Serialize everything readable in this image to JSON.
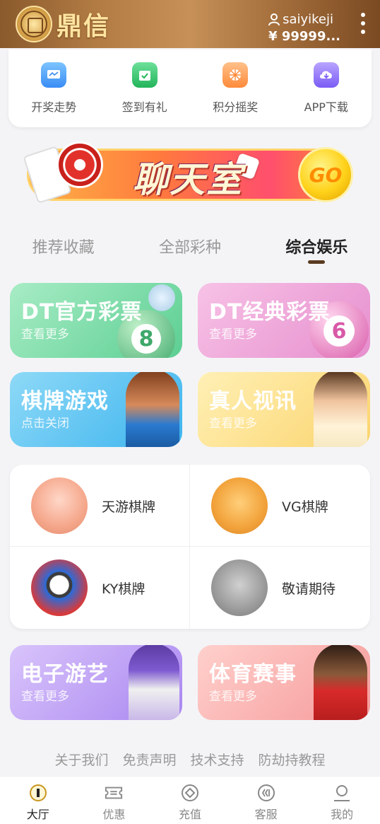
{
  "header": {
    "logo_text": "鼎信",
    "username": "saiyikeji",
    "balance": "¥ 99999..."
  },
  "quick_links": [
    {
      "label": "开奖走势",
      "icon": "trend-chart-icon",
      "color": "#4aa8ff"
    },
    {
      "label": "签到有礼",
      "icon": "calendar-check-icon",
      "color": "#34c46a"
    },
    {
      "label": "积分摇奖",
      "icon": "lottery-wheel-icon",
      "color": "#ff9a4a"
    },
    {
      "label": "APP下载",
      "icon": "download-icon",
      "color": "#8a6bff"
    }
  ],
  "banner": {
    "text": "聊天室",
    "button": "GO"
  },
  "tabs": [
    {
      "label": "推荐收藏",
      "active": false
    },
    {
      "label": "全部彩种",
      "active": false
    },
    {
      "label": "综合娱乐",
      "active": true
    }
  ],
  "feature_cards": [
    {
      "title": "DT官方彩票",
      "subtitle": "查看更多",
      "ball_number": "8",
      "color": "#7fdcab"
    },
    {
      "title": "DT经典彩票",
      "subtitle": "查看更多",
      "ball_number": "6",
      "color": "#f2a6d6"
    },
    {
      "title": "棋牌游戏",
      "subtitle": "点击关闭",
      "color": "#62c9f3"
    },
    {
      "title": "真人视讯",
      "subtitle": "查看更多",
      "color": "#fcd97a"
    }
  ],
  "game_grid": [
    {
      "label": "天游棋牌",
      "icon": "tianyou-avatar-icon"
    },
    {
      "label": "VG棋牌",
      "icon": "vg-mascot-icon"
    },
    {
      "label": "KY棋牌",
      "icon": "ky-panda-icon"
    },
    {
      "label": "敬请期待",
      "icon": "coming-soon-avatar-icon"
    }
  ],
  "bottom_cards": [
    {
      "title": "电子游艺",
      "subtitle": "查看更多",
      "color": "#c8a7f7"
    },
    {
      "title": "体育赛事",
      "subtitle": "查看更多",
      "color": "#f8b0b0"
    }
  ],
  "footer_links": [
    "关于我们",
    "免责声明",
    "技术支持",
    "防劫持教程"
  ],
  "tabbar": [
    {
      "label": "大厅",
      "icon": "home-icon",
      "active": true
    },
    {
      "label": "优惠",
      "icon": "ticket-icon",
      "active": false
    },
    {
      "label": "充值",
      "icon": "recharge-icon",
      "active": false
    },
    {
      "label": "客服",
      "icon": "service-icon",
      "active": false
    },
    {
      "label": "我的",
      "icon": "profile-icon",
      "active": false
    }
  ]
}
